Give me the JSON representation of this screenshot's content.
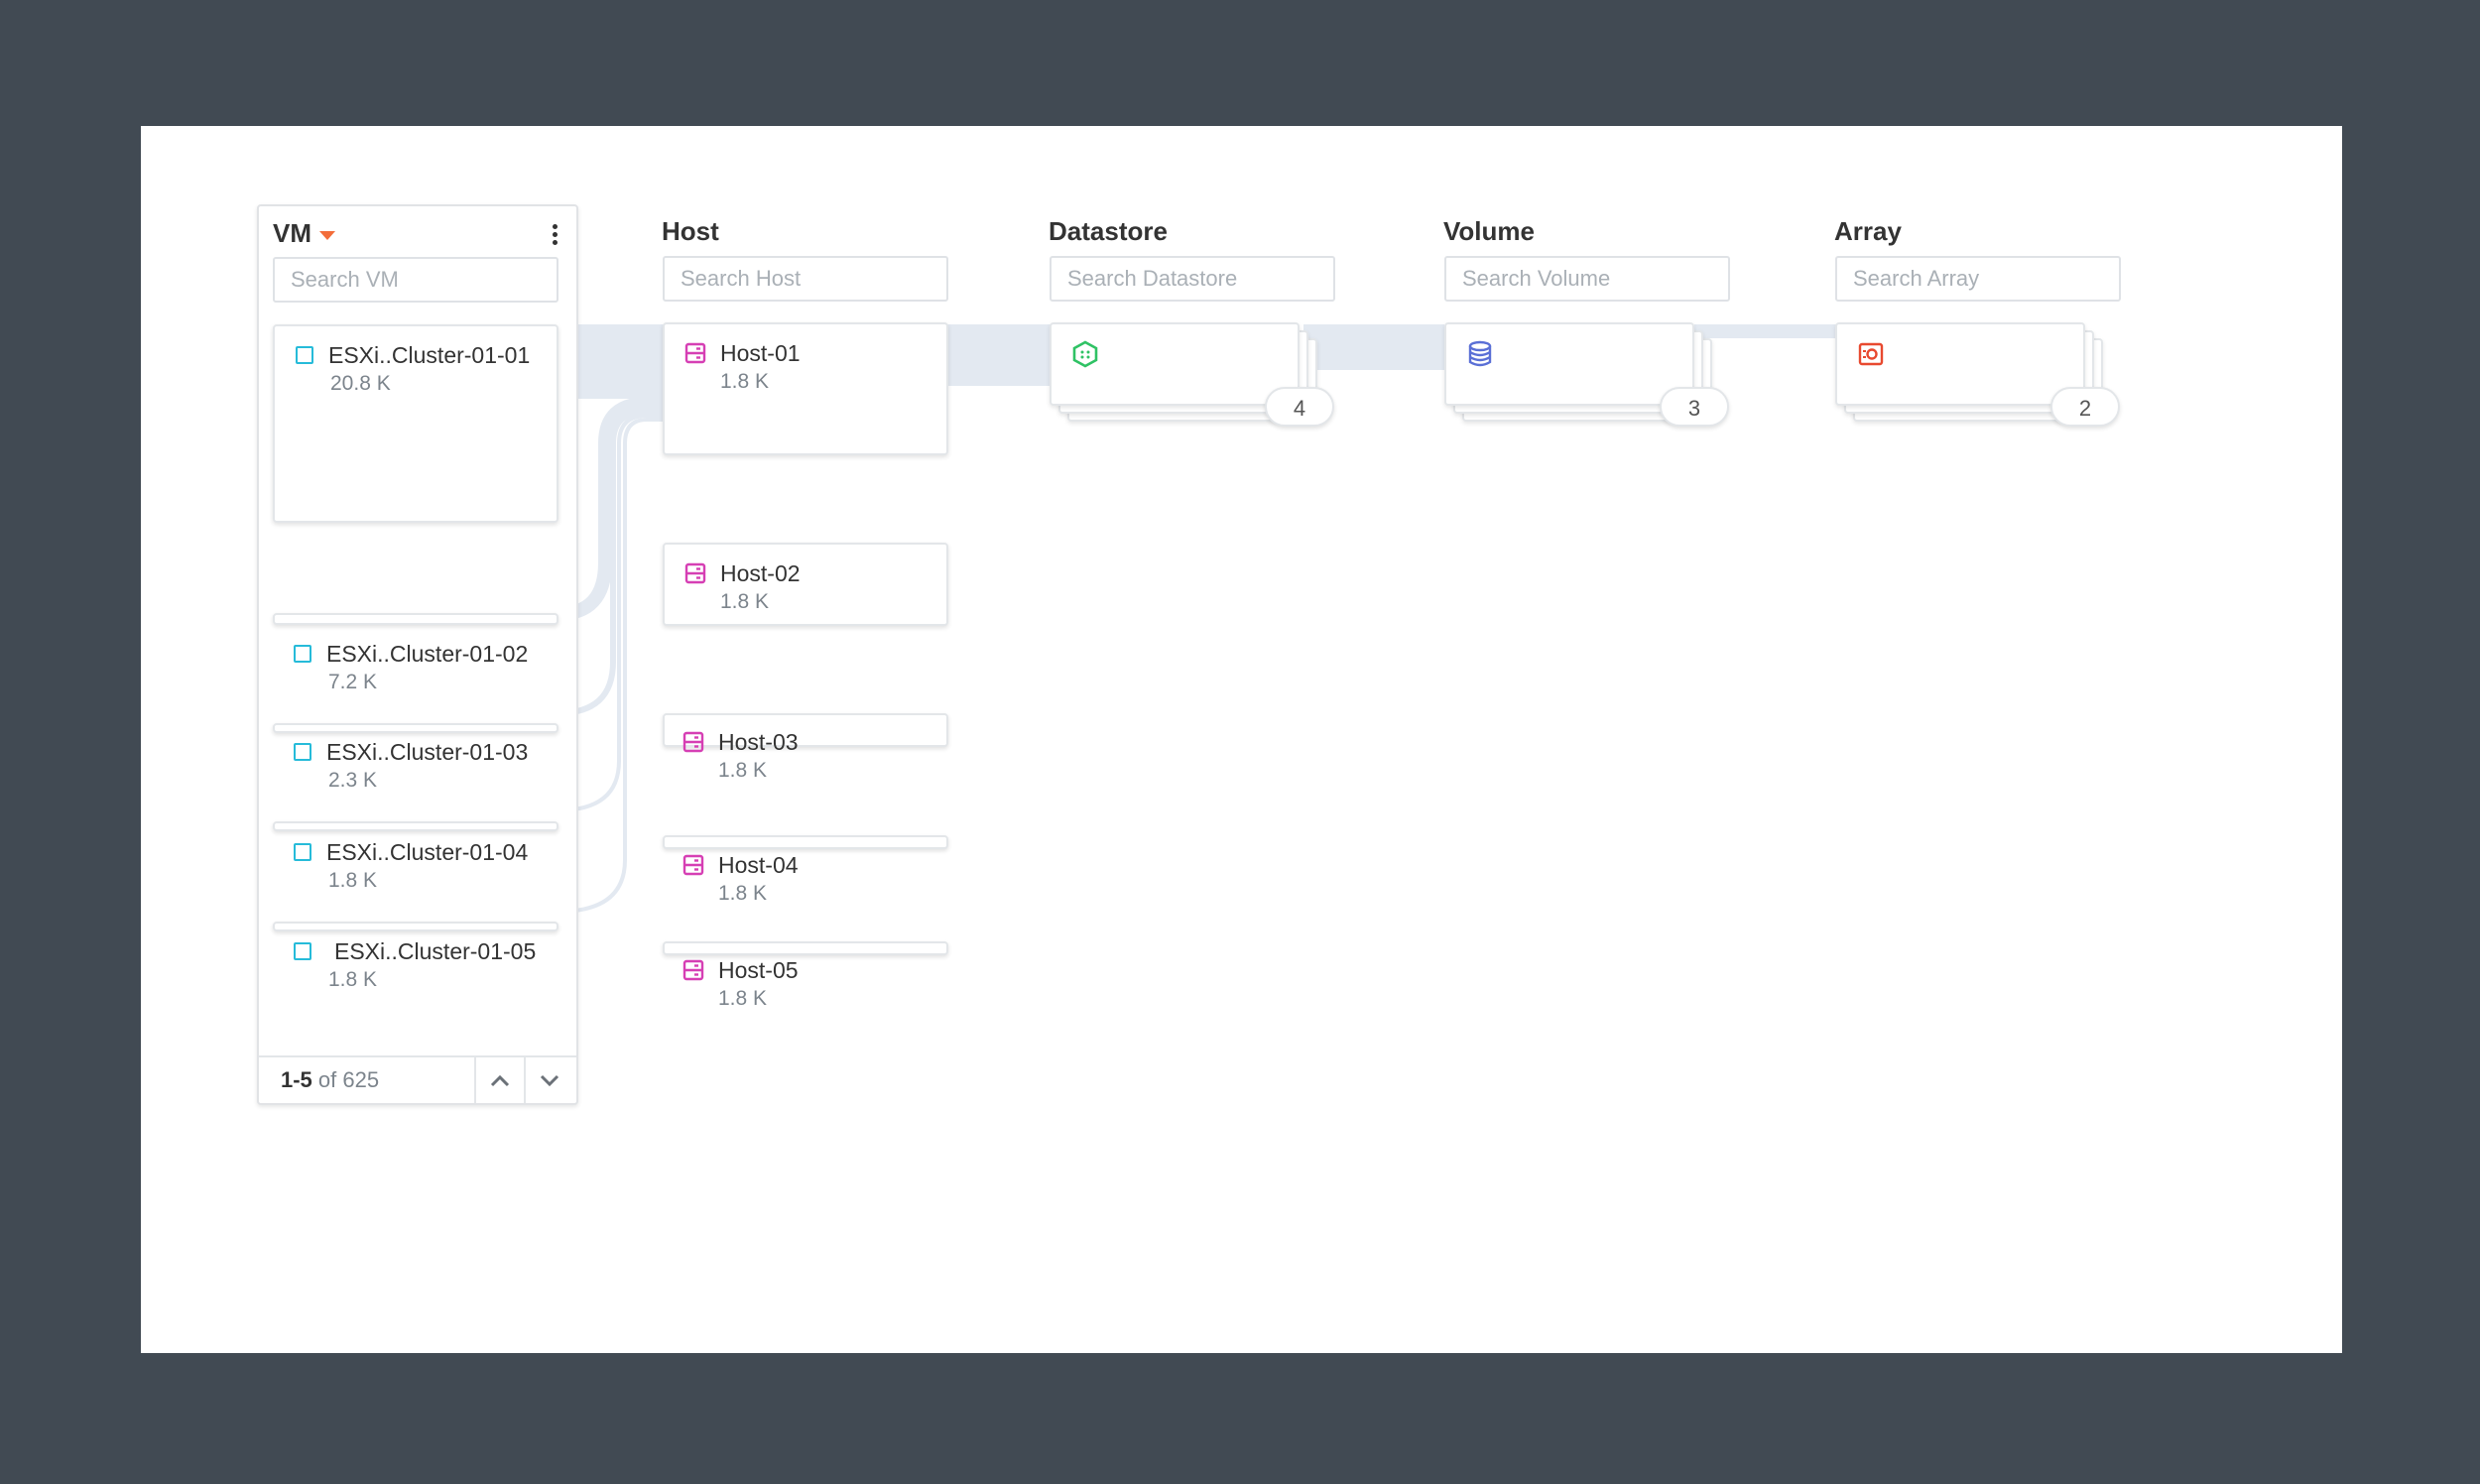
{
  "columns": {
    "vm": {
      "title": "VM",
      "search_placeholder": "Search VM"
    },
    "host": {
      "title": "Host",
      "search_placeholder": "Search Host"
    },
    "datastore": {
      "title": "Datastore",
      "search_placeholder": "Search Datastore",
      "count": "4"
    },
    "volume": {
      "title": "Volume",
      "search_placeholder": "Search Volume",
      "count": "3"
    },
    "array": {
      "title": "Array",
      "search_placeholder": "Search Array",
      "count": "2"
    }
  },
  "vms": [
    {
      "name": "ESXi..Cluster-01-01",
      "value": "20.8 K"
    },
    {
      "name": "ESXi..Cluster-01-02",
      "value": "7.2 K"
    },
    {
      "name": "ESXi..Cluster-01-03",
      "value": "2.3 K"
    },
    {
      "name": "ESXi..Cluster-01-04",
      "value": "1.8 K"
    },
    {
      "name": "ESXi..Cluster-01-05",
      "value": "1.8 K"
    }
  ],
  "hosts": [
    {
      "name": "Host-01",
      "value": "1.8 K"
    },
    {
      "name": "Host-02",
      "value": "1.8 K"
    },
    {
      "name": "Host-03",
      "value": "1.8 K"
    },
    {
      "name": "Host-04",
      "value": "1.8 K"
    },
    {
      "name": "Host-05",
      "value": "1.8 K"
    }
  ],
  "pager": {
    "range": "1-5",
    "of_text": "of 625"
  },
  "icons": {
    "vm": "vm-checkbox-icon",
    "host": "server-icon",
    "datastore": "hexagon-icon",
    "volume": "database-icon",
    "array": "storage-array-icon"
  },
  "colors": {
    "vm_icon": "#26bbd9",
    "host_icon": "#d63fb4",
    "datastore_icon": "#2fc264",
    "volume_icon": "#5a6fd6",
    "array_icon": "#e8492f",
    "flow": "#e3e9f1",
    "accent": "#f36d3a"
  }
}
